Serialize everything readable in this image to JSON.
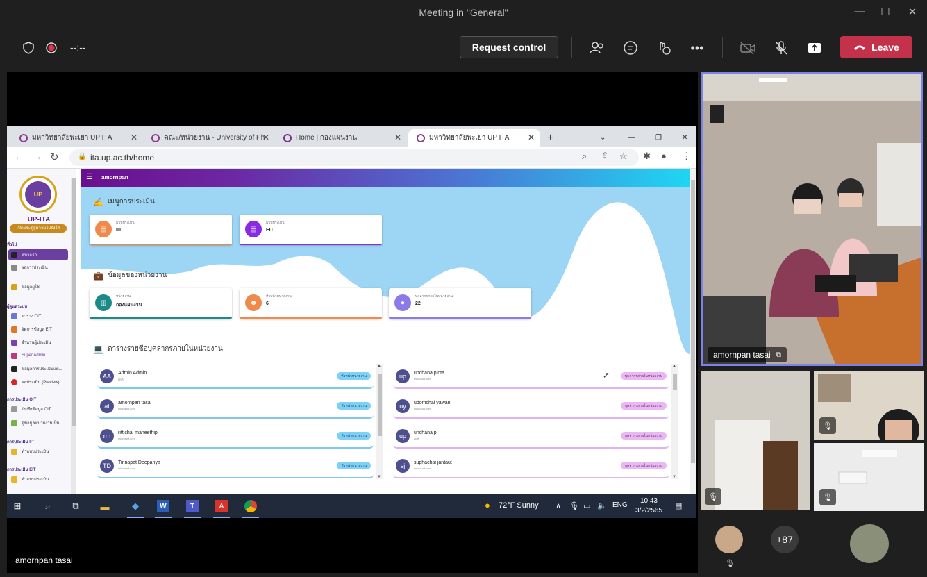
{
  "window": {
    "title": "Meeting in \"General\""
  },
  "toolbar": {
    "timer": "--:--",
    "request_control": "Request control",
    "leave": "Leave",
    "leave_color": "#c4314b"
  },
  "browser": {
    "tabs": [
      {
        "label": "มหาวิทยาลัยพะเยา UP ITA"
      },
      {
        "label": "คณะ/หน่วยงาน - University of Ph"
      },
      {
        "label": "Home | กองแผนงาน"
      },
      {
        "label": "มหาวิทยาลัยพะเยา UP ITA"
      }
    ],
    "url": "ita.up.ac.th/home"
  },
  "site": {
    "logo_text": "UP",
    "logo_name": "UP-ITA",
    "logo_tag": "เปิดประตูสู่ความโปร่งใส",
    "user": "amornpan",
    "sidebar": {
      "sections": [
        "ทั่วไป",
        "ผู้ดูแลระบบ",
        "การประเมิน OIT",
        "การประเมิน IIT",
        "การประเมิน EIT"
      ],
      "items": [
        "หน้าแรก",
        "ผลการประเมิน",
        "ข้อมูลผู้ใช้",
        "ตาราง OIT",
        "จัดการข้อมูล EIT",
        "จำนวนผู้ประเมิน",
        "Super Admin",
        "ข้อมูลการประเมินแต่...",
        "ผลประเมิน (Preview)",
        "บันทึกข้อมูล OIT",
        "ดูข้อมูลหน่วยงานเป็น...",
        "ทำแบบประเมิน",
        "ทำแบบประเมิน"
      ]
    },
    "menu_section": "เมนูการประเมิน",
    "eval_cards": [
      {
        "label": "แบบประเมิน",
        "value": "IIT"
      },
      {
        "label": "แบบประเมิน",
        "value": "EIT"
      }
    ],
    "unit_section": "ข้อมูลของหน่วยงาน",
    "unit_cards": [
      {
        "label": "หน่วยงาน",
        "value": "กองแผนงาน"
      },
      {
        "label": "หัวหน้าหน่วยงาน",
        "value": "6"
      },
      {
        "label": "บุคลากรภายในหน่วยงาน",
        "value": "22"
      }
    ],
    "staff_section": "ตารางรายชื่อบุคลากรภายในหน่วยงาน",
    "staff_left": [
      {
        "initials": "AA",
        "name": "Admin Admin",
        "email": "ปกติ",
        "badge": "หัวหน้าหน่วยงาน"
      },
      {
        "initials": "at",
        "name": "amornpan tasai",
        "email": "microsoft.com",
        "badge": "หัวหน้าหน่วยงาน"
      },
      {
        "initials": "rm",
        "name": "rittichai maneethip",
        "email": "microsoft.com",
        "badge": "หัวหน้าหน่วยงาน"
      },
      {
        "initials": "TD",
        "name": "Tinnapat Deepanya",
        "email": "microsoft.com",
        "badge": "หัวหน้าหน่วยงาน"
      }
    ],
    "staff_right": [
      {
        "initials": "up",
        "name": "unchana pinta",
        "email": "microsoft.com",
        "badge": "บุคลากรภายในหน่วยงาน"
      },
      {
        "initials": "uy",
        "name": "udomchai yawan",
        "email": "microsoft.com",
        "badge": "บุคลากรภายในหน่วยงาน"
      },
      {
        "initials": "up",
        "name": "unchana pi",
        "email": "ปกติ",
        "badge": "บุคลากรภายในหน่วยงาน"
      },
      {
        "initials": "sj",
        "name": "suphachai jantaut",
        "email": "microsoft.com",
        "badge": "บุคลากรภายในหน่วยงาน"
      }
    ]
  },
  "taskbar": {
    "weather": "72°F  Sunny",
    "lang": "ENG",
    "time": "10:43",
    "date": "3/2/2565"
  },
  "participants": {
    "main_name": "amornpan tasai",
    "stage_name": "amornpan tasai",
    "more_count": "+87"
  }
}
